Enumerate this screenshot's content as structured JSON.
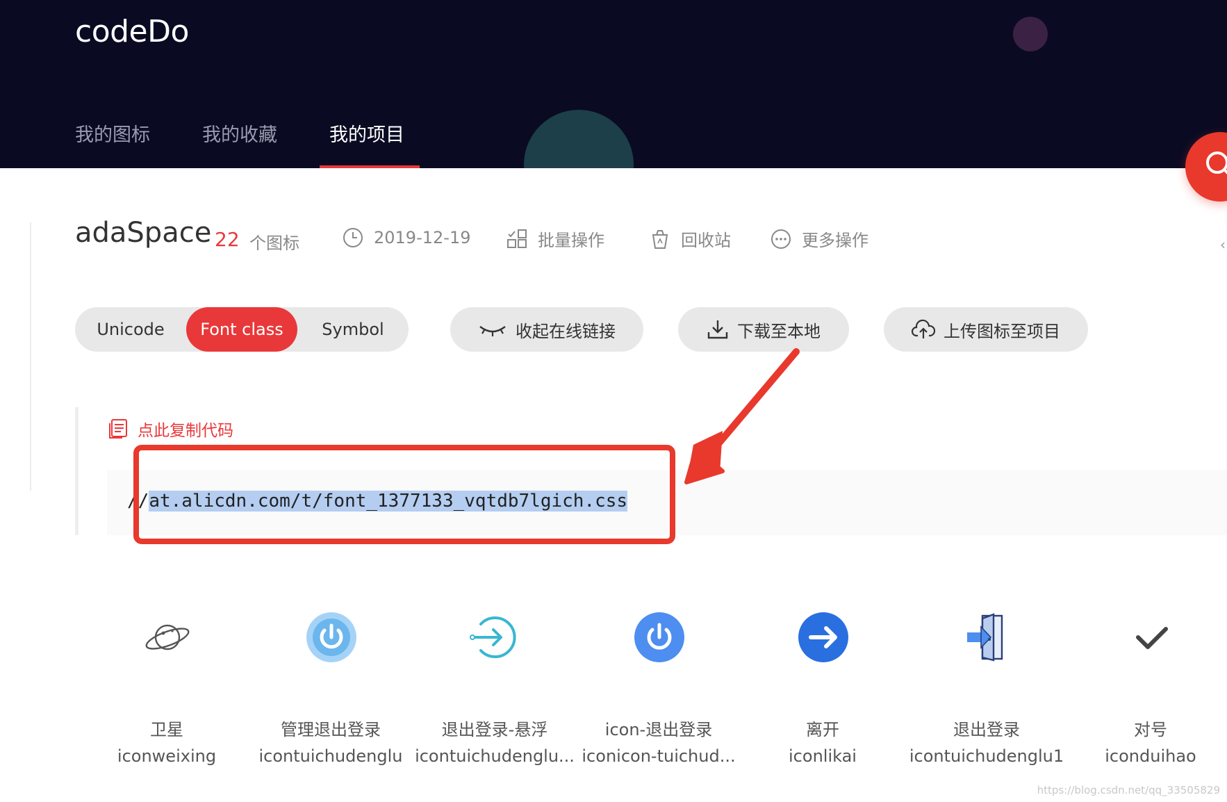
{
  "app": {
    "logo": "codeDo"
  },
  "nav": {
    "tabs": [
      {
        "label": "我的图标",
        "active": false
      },
      {
        "label": "我的收藏",
        "active": false
      },
      {
        "label": "我的项目",
        "active": true
      }
    ],
    "accent_color": "#e9383a",
    "background_color": "#0a0b23"
  },
  "project": {
    "name": "adaSpace",
    "icon_count": "22",
    "icon_count_label": "个图标",
    "date": "2019-12-19",
    "actions": {
      "batch": "批量操作",
      "trash": "回收站",
      "more": "更多操作"
    }
  },
  "toolbar": {
    "segments": [
      {
        "label": "Unicode",
        "active": false
      },
      {
        "label": "Font class",
        "active": true
      },
      {
        "label": "Symbol",
        "active": false
      }
    ],
    "collapse_link": "收起在线链接",
    "download": "下载至本地",
    "upload": "上传图标至项目"
  },
  "code": {
    "copy_label": "点此复制代码",
    "prefix": "//",
    "url": "at.alicdn.com/t/font_1377133_vqtdb7lgich.css"
  },
  "icons": [
    {
      "name": "卫星",
      "font_class": "iconweixing",
      "glyph": "planet-icon"
    },
    {
      "name": "管理退出登录",
      "font_class": "icontuichudenglu",
      "glyph": "power-circle-icon"
    },
    {
      "name": "退出登录-悬浮",
      "font_class": "icontuichudenglu...",
      "glyph": "sign-in-arrow-icon"
    },
    {
      "name": "icon-退出登录",
      "font_class": "iconicon-tuichud...",
      "glyph": "power-icon"
    },
    {
      "name": "离开",
      "font_class": "iconlikai",
      "glyph": "arrow-right-circle-icon"
    },
    {
      "name": "退出登录",
      "font_class": "icontuichudenglu1",
      "glyph": "door-exit-icon"
    },
    {
      "name": "对号",
      "font_class": "iconduihao",
      "glyph": "checkmark-icon"
    }
  ],
  "watermark": "https://blog.csdn.net/qq_33505829"
}
